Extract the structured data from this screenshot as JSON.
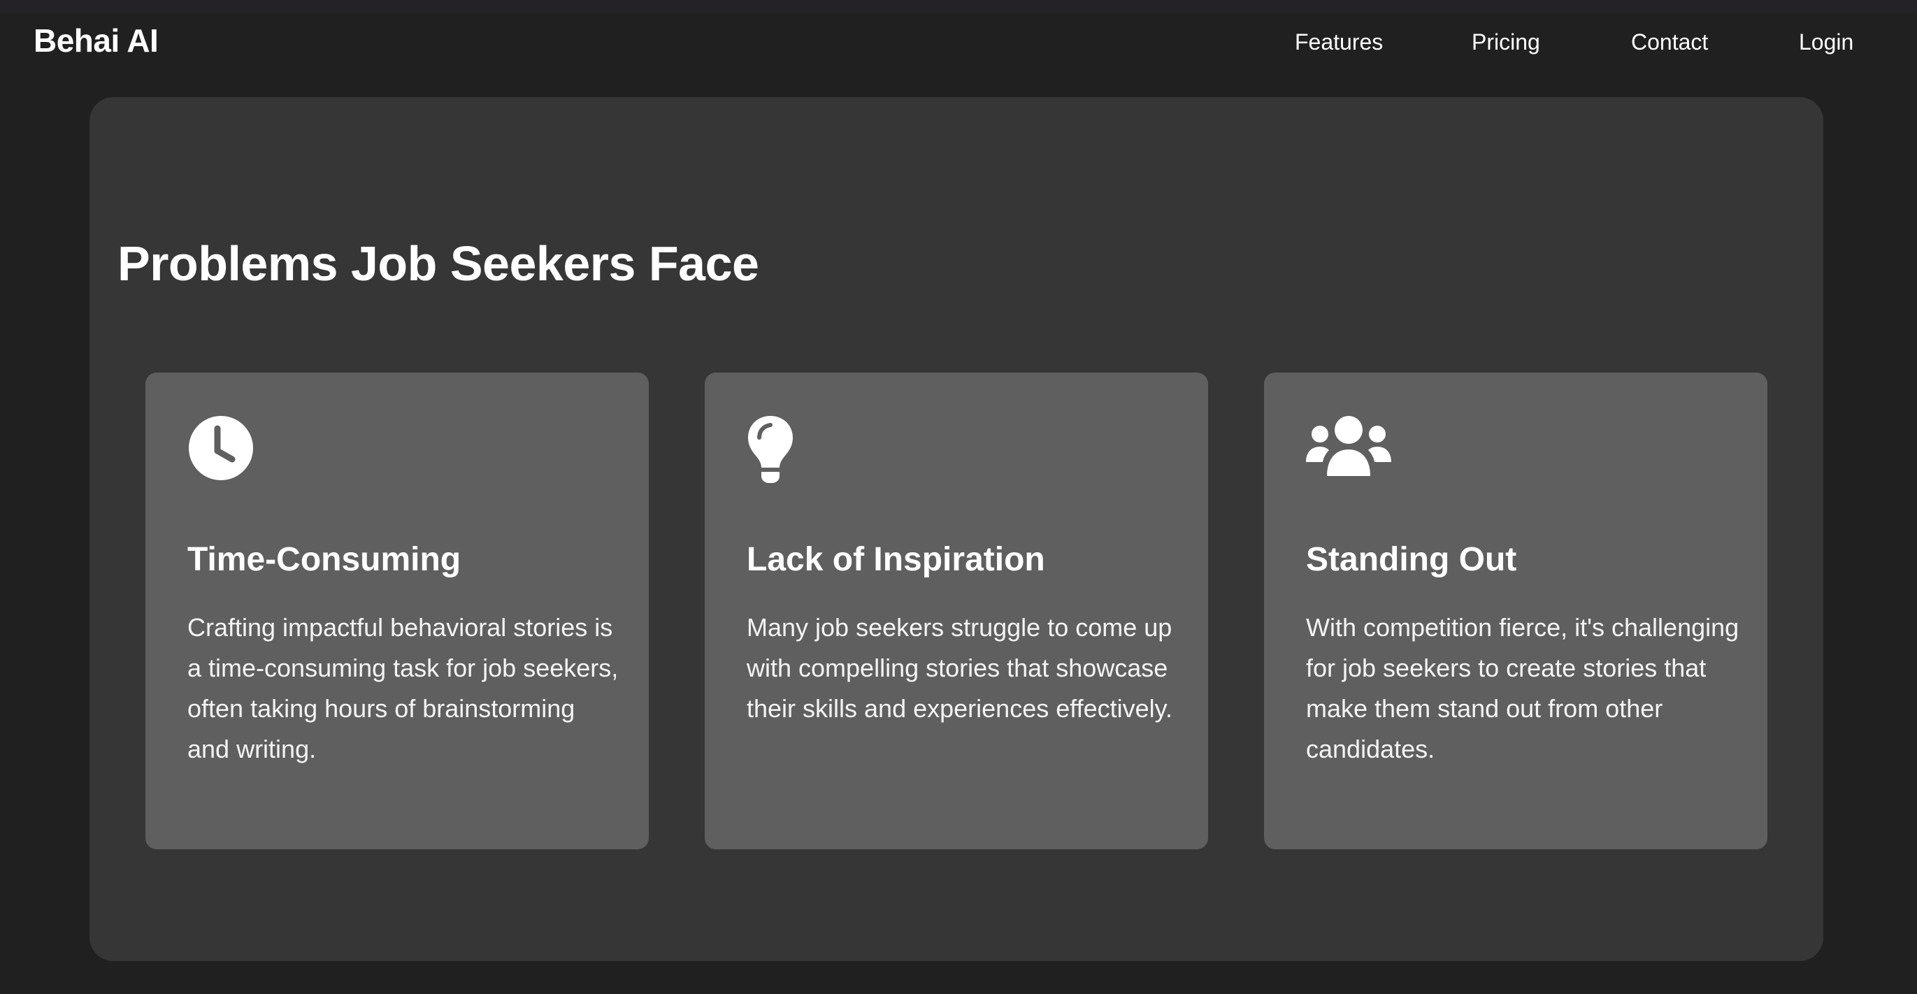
{
  "navbar": {
    "brand": "Behai AI",
    "links": [
      {
        "label": "Features"
      },
      {
        "label": "Pricing"
      },
      {
        "label": "Contact"
      },
      {
        "label": "Login"
      }
    ]
  },
  "problems": {
    "title": "Problems Job Seekers Face",
    "cards": [
      {
        "icon": "clock-icon",
        "title": "Time-Consuming",
        "text": "Crafting impactful behavioral stories is a time-consuming task for job seekers, often taking hours of brainstorming and writing."
      },
      {
        "icon": "lightbulb-icon",
        "title": "Lack of Inspiration",
        "text": "Many job seekers struggle to come up with compelling stories that showcase their skills and experiences effectively."
      },
      {
        "icon": "users-icon",
        "title": "Standing Out",
        "text": "With competition fierce, it's challenging for job seekers to create stories that make them stand out from other candidates."
      }
    ]
  },
  "colors": {
    "page_background": "#202020",
    "panel_background": "#363636",
    "card_background": "#5f5f5f",
    "text": "#ffffff"
  }
}
